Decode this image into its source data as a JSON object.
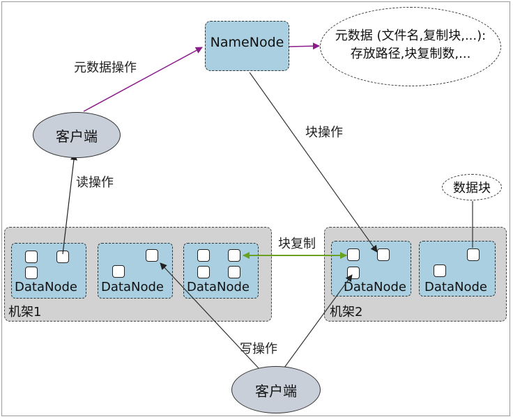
{
  "namenode": {
    "label": "NameNode"
  },
  "metadata": {
    "line1": "元数据 (文件名,复制块,...):",
    "line2": "存放路径,块复制数,..."
  },
  "client_top": {
    "label": "客户端"
  },
  "client_bottom": {
    "label": "客户端"
  },
  "block_bubble": {
    "label": "数据块"
  },
  "edges": {
    "metadata_op": "元数据操作",
    "block_op": "块操作",
    "read_op": "读操作",
    "write_op": "写操作",
    "block_replication": "块复制"
  },
  "rack1": {
    "label": "机架1",
    "datanodes": [
      "DataNode",
      "DataNode",
      "DataNode"
    ]
  },
  "rack2": {
    "label": "机架2",
    "datanodes": [
      "DataNode",
      "DataNode"
    ]
  },
  "colors": {
    "metadata_arrow": "#8b1a8b",
    "replication_arrow": "#6aa121",
    "node_fill": "#a9cfe0",
    "rack_fill": "#d2d2d2",
    "client_fill": "#c9cfd9"
  }
}
